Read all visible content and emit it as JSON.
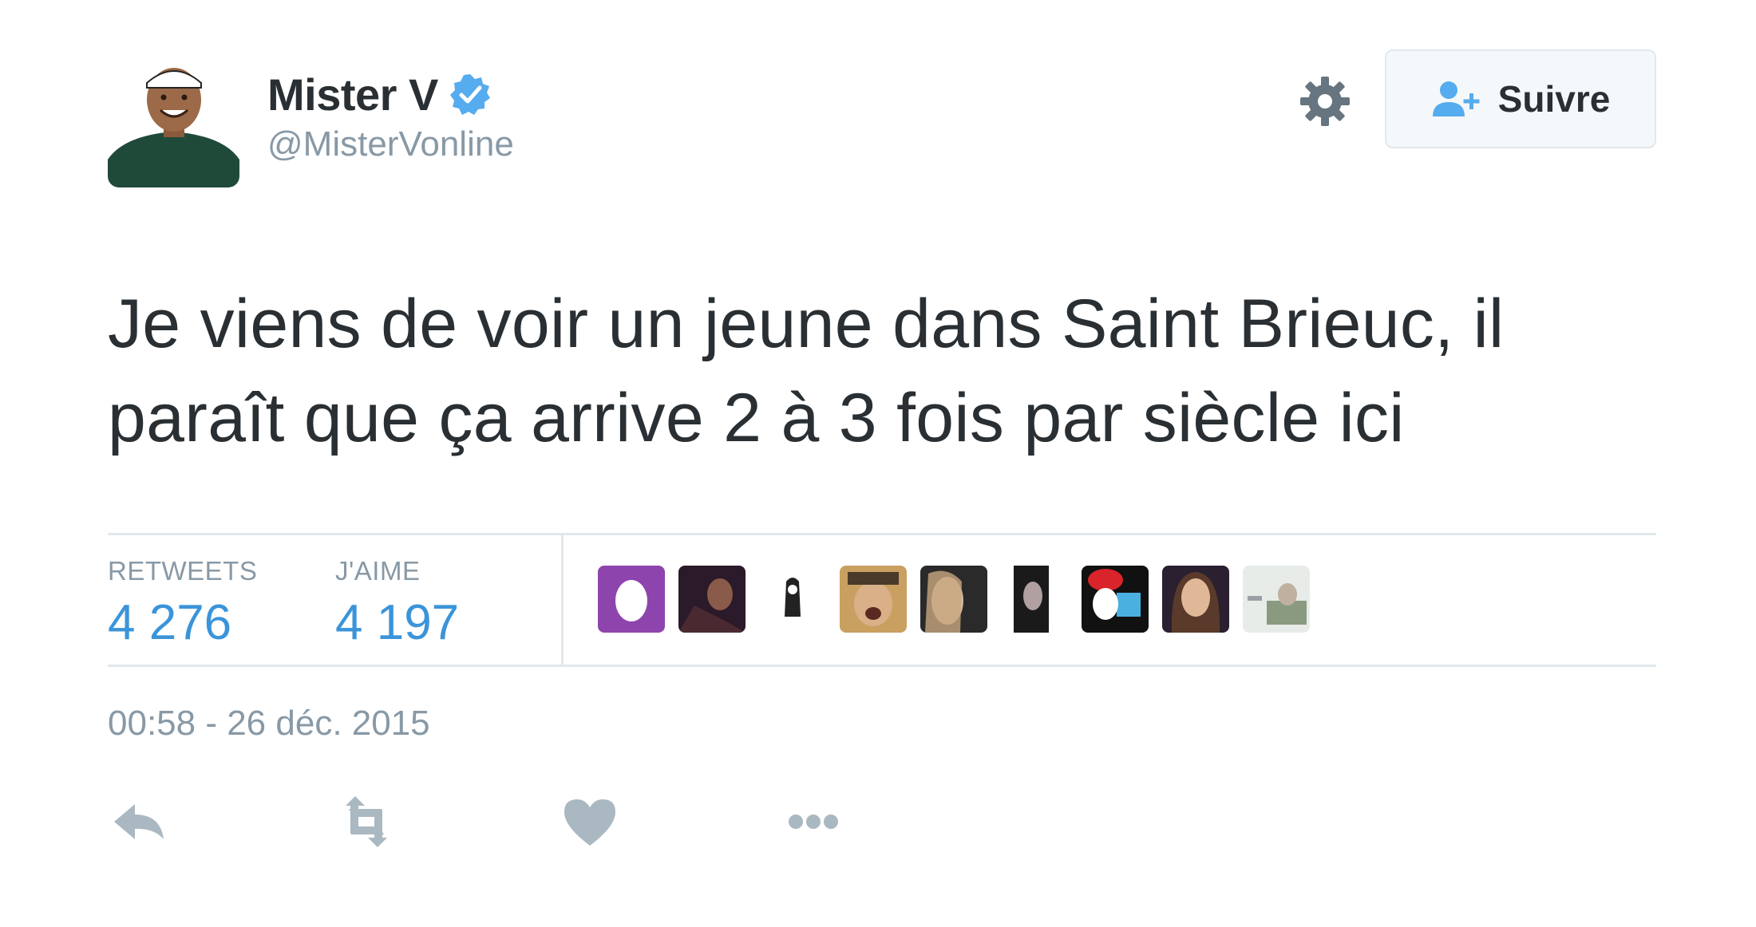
{
  "author": {
    "name": "Mister V",
    "handle": "@MisterVonline",
    "verified": true
  },
  "header": {
    "follow_label": "Suivre",
    "settings_icon": "gear-icon",
    "follow_icon": "add-user-icon"
  },
  "tweet": {
    "text": "Je viens de voir un jeune dans Saint Brieuc, il paraît que ça arrive 2 à 3 fois par siècle ici",
    "timestamp": "00:58 - 26 déc. 2015"
  },
  "stats": {
    "retweets_label": "RETWEETS",
    "retweets_value": "4 276",
    "likes_label": "J'AIME",
    "likes_value": "4 197"
  },
  "likers_count_shown": 9,
  "actions": [
    {
      "name": "reply-icon"
    },
    {
      "name": "retweet-icon"
    },
    {
      "name": "like-icon"
    },
    {
      "name": "more-icon"
    }
  ],
  "colors": {
    "text": "#292f33",
    "muted": "#8899a6",
    "link_blue": "#3b94d9",
    "verified_blue": "#55acee",
    "border": "#e1e8ed",
    "action_gray": "#aab8c2"
  }
}
